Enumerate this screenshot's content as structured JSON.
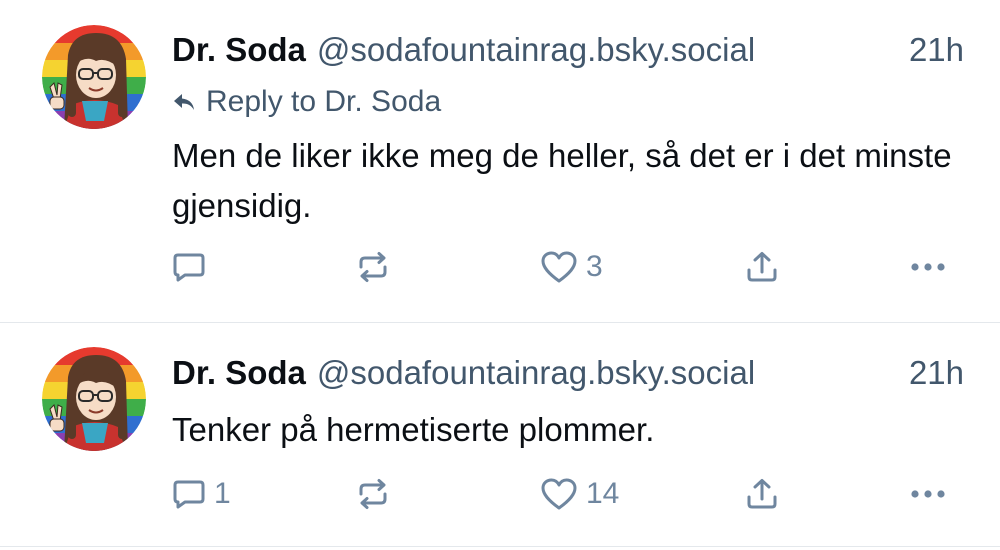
{
  "posts": [
    {
      "author": "Dr. Soda",
      "handle": "@sodafountainrag.bsky.social",
      "time": "21h",
      "reply_to": "Reply to Dr. Soda",
      "text": "Men de liker ikke meg de heller, så det er i det minste gjensidig.",
      "reply_count": "",
      "like_count": "3"
    },
    {
      "author": "Dr. Soda",
      "handle": "@sodafountainrag.bsky.social",
      "time": "21h",
      "text": "Tenker på hermetiserte plommer.",
      "reply_count": "1",
      "like_count": "14"
    }
  ],
  "icons": {
    "reply": "speech-bubble-icon",
    "repost": "repost-arrows-icon",
    "like": "heart-icon",
    "share": "share-upload-icon",
    "more": "ellipsis-icon",
    "reply_indicator": "reply-arrow-icon"
  },
  "colors": {
    "text": "#0b0f14",
    "muted": "#42576c",
    "icon": "#6f869f",
    "divider": "#e4e8ec"
  }
}
